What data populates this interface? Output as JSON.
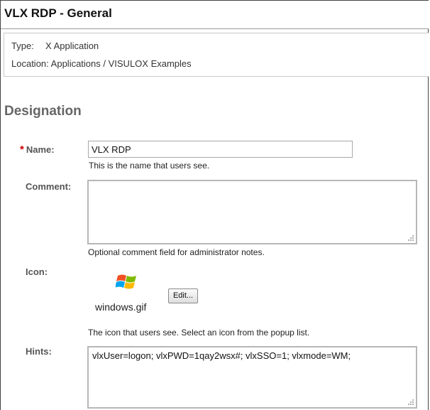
{
  "header": {
    "title": "VLX RDP - General"
  },
  "info": {
    "type_label": "Type:",
    "type_value": "X Application",
    "location_label": "Location:",
    "location_value": "Applications / VISULOX Examples"
  },
  "designation": {
    "heading": "Designation",
    "required_marker": "*",
    "name": {
      "label": "Name:",
      "value": "VLX RDP",
      "help": "This is the name that users see."
    },
    "comment": {
      "label": "Comment:",
      "value": "",
      "help": "Optional comment field for administrator notes."
    },
    "icon": {
      "label": "Icon:",
      "filename": "windows.gif",
      "edit_label": "Edit...",
      "help": "The icon that users see. Select an icon from the popup list."
    },
    "hints": {
      "label": "Hints:",
      "value": "vlxUser=logon; vlxPWD=1qay2wsx#; vlxSSO=1; vlxmode=WM;"
    }
  },
  "colors": {
    "required": "#cc0000",
    "label": "#555555",
    "heading": "#666666"
  },
  "icons": [
    "windows-logo-icon",
    "resize-grip-icon"
  ]
}
